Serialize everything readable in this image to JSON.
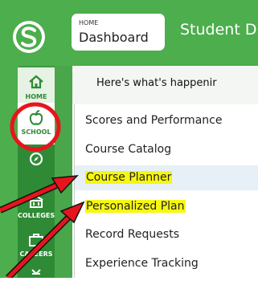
{
  "header": {
    "breadcrumb_small": "HOME",
    "breadcrumb_main": "Dashboard",
    "app_title": "Student D"
  },
  "nav": {
    "home": "HOME",
    "school": "SCHOOL",
    "college": "COLLEGES",
    "careers": "CAREERS"
  },
  "greeting": "Here's what's happenir",
  "menu": [
    {
      "label": "Scores and Performance",
      "highlighted": false
    },
    {
      "label": "Course Catalog",
      "highlighted": false
    },
    {
      "label": "Course Planner",
      "highlighted": true
    },
    {
      "label": "Personalized Plan",
      "highlighted": true
    },
    {
      "label": "Record Requests",
      "highlighted": false
    },
    {
      "label": "Experience Tracking",
      "highlighted": false
    }
  ],
  "colors": {
    "brand_green": "#4cae4c",
    "annotation_red": "#e8141c",
    "highlight_yellow": "#f7f711"
  }
}
